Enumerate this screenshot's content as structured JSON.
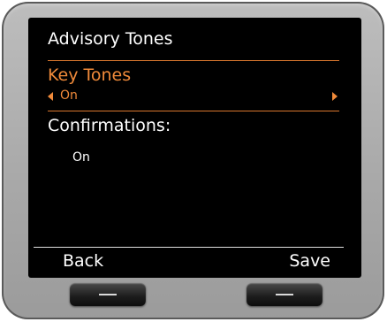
{
  "screen": {
    "title": "Advisory Tones",
    "key_tones": {
      "label": "Key Tones",
      "value": "On"
    },
    "confirmations": {
      "label": "Confirmations:",
      "value": "On"
    }
  },
  "softkeys": {
    "left_label": "Back",
    "right_label": "Save"
  },
  "icons": {
    "selector_left": "triangle-left-icon",
    "selector_right": "triangle-right-icon",
    "hardware_key_mark": "dash-icon"
  },
  "colors": {
    "accent": "#f08a3a",
    "screen_background": "#000000",
    "text": "#ffffff",
    "device_body": "#a9a9a9"
  }
}
